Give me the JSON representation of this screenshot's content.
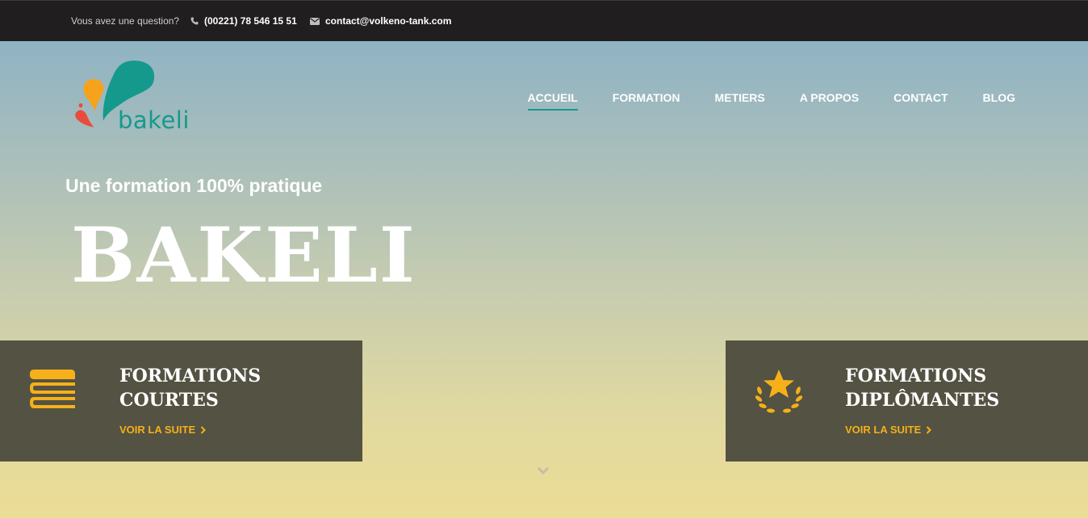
{
  "topbar": {
    "question": "Vous avez une question?",
    "phone": "(00221) 78 546 15 51",
    "email": "contact@volkeno-tank.com"
  },
  "logo": {
    "text": "bakeli"
  },
  "nav": {
    "items": [
      "ACCUEIL",
      "FORMATION",
      "METIERS",
      "A PROPOS",
      "CONTACT",
      "BLOG"
    ],
    "active": "ACCUEIL"
  },
  "hero": {
    "tagline": "Une formation 100% pratique",
    "title": "BAKELI"
  },
  "cards": [
    {
      "title_line1": "FORMATIONS",
      "title_line2": "COURTES",
      "more": "VOIR LA SUITE",
      "icon": "books-icon"
    },
    {
      "title_line1": "FORMATIONS",
      "title_line2": "DIPLÔMANTES",
      "more": "VOIR LA SUITE",
      "icon": "award-star-icon"
    }
  ],
  "colors": {
    "topbar": "#201e1f",
    "accent_teal": "#16998d",
    "accent_orange": "#f5b01a",
    "card_bg": "#545242",
    "logo_orange": "#f7a21b",
    "logo_red": "#e94b3c"
  }
}
